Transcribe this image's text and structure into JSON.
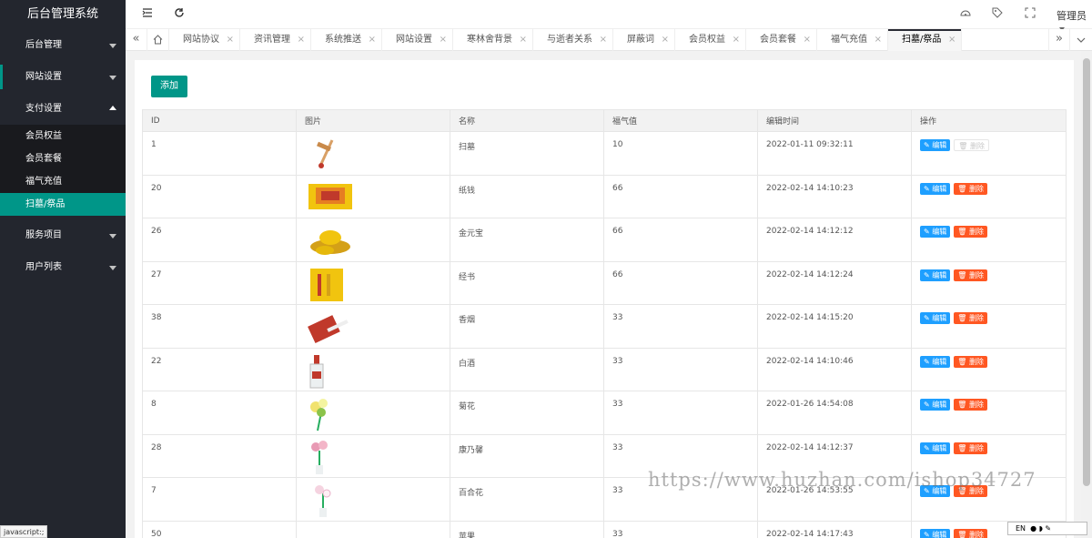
{
  "app": {
    "title": "后台管理系统"
  },
  "sidebar": {
    "items": [
      {
        "label": "后台管理"
      },
      {
        "label": "网站设置"
      },
      {
        "label": "支付设置"
      },
      {
        "label": "服务项目"
      },
      {
        "label": "用户列表"
      }
    ],
    "submenu": [
      "会员权益",
      "会员套餐",
      "福气充值",
      "扫墓/祭品"
    ]
  },
  "header": {
    "user": "管理员"
  },
  "tabs": [
    "网站协议",
    "资讯管理",
    "系统推送",
    "网站设置",
    "寒林舍背景",
    "与逝者关系",
    "屏蔽词",
    "会员权益",
    "会员套餐",
    "福气充值",
    "扫墓/祭品"
  ],
  "main": {
    "add_label": "添加",
    "columns": [
      "ID",
      "图片",
      "名称",
      "福气值",
      "编辑时间",
      "操作"
    ],
    "edit_label": "编辑",
    "delete_label": "删除",
    "rows": [
      {
        "id": "1",
        "name": "扫墓",
        "value": "10",
        "time": "2022-01-11 09:32:11",
        "image": "broom-icon"
      },
      {
        "id": "20",
        "name": "纸钱",
        "value": "66",
        "time": "2022-02-14 14:10:23",
        "image": "paper-money-icon"
      },
      {
        "id": "26",
        "name": "金元宝",
        "value": "66",
        "time": "2022-02-14 14:12:12",
        "image": "gold-ingot-icon"
      },
      {
        "id": "27",
        "name": "经书",
        "value": "66",
        "time": "2022-02-14 14:12:24",
        "image": "scripture-book-icon"
      },
      {
        "id": "38",
        "name": "香烟",
        "value": "33",
        "time": "2022-02-14 14:15:20",
        "image": "cigarettes-icon"
      },
      {
        "id": "22",
        "name": "白酒",
        "value": "33",
        "time": "2022-02-14 14:10:46",
        "image": "liquor-bottle-icon"
      },
      {
        "id": "8",
        "name": "菊花",
        "value": "33",
        "time": "2022-01-26 14:54:08",
        "image": "chrysanthemum-icon"
      },
      {
        "id": "28",
        "name": "康乃馨",
        "value": "33",
        "time": "2022-02-14 14:12:37",
        "image": "carnation-icon"
      },
      {
        "id": "7",
        "name": "百合花",
        "value": "33",
        "time": "2022-01-26 14:53:55",
        "image": "lily-icon"
      },
      {
        "id": "50",
        "name": "苹果",
        "value": "33",
        "time": "2022-02-14 14:17:43",
        "image": "apple-icon"
      }
    ]
  },
  "watermark": "https://www.huzhan.com/ishop34727",
  "status_tip": "javascript:;",
  "ime": "EN"
}
